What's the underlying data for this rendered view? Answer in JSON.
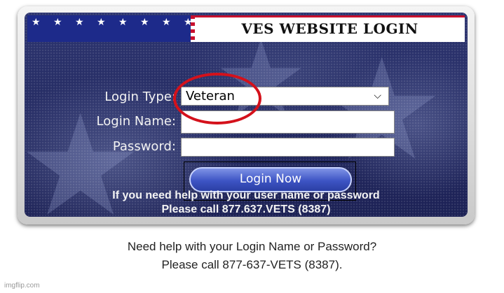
{
  "banner": {
    "stars": "★ ★ ★ ★ ★ ★ ★ ★ ★ ★ ★ ★ ★ ★ ★ ★",
    "title": "VES WEBSITE LOGIN"
  },
  "form": {
    "login_type_label": "Login Type:",
    "login_type_value": "Veteran",
    "login_name_label": "Login Name:",
    "login_name_value": "",
    "password_label": "Password:",
    "password_value": "",
    "login_button": "Login Now"
  },
  "panel_help": {
    "line1": "If you need help with your user name or password",
    "line2": "Please call 877.637.VETS (8387)"
  },
  "footer": {
    "line1": "Need help with your Login Name or Password?",
    "line2": "Please call 877-637-VETS (8387)."
  },
  "watermark": "imgflip.com",
  "colors": {
    "panel_bg": "#232a66",
    "stripe_red": "#c8102e",
    "annotation_circle": "#d4111b",
    "button_blue": "#3d54c4"
  }
}
